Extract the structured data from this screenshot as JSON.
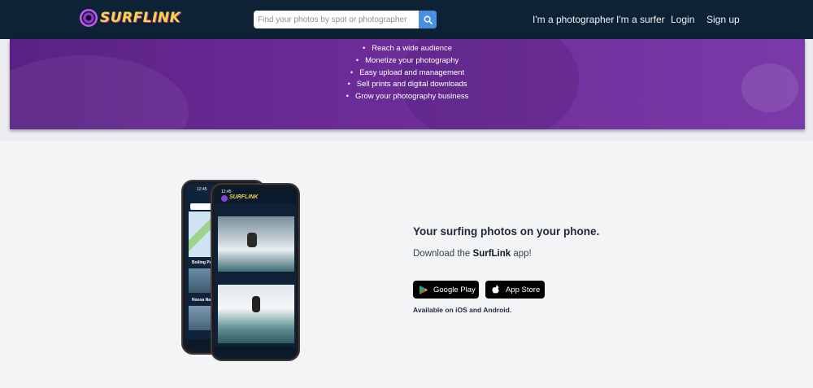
{
  "brand": {
    "name": "SURFLINK"
  },
  "search": {
    "placeholder": "Find your photos by spot or photographer"
  },
  "nav": {
    "photographer": "I'm a photographer",
    "surfer": "I'm a surfer",
    "login": "Login",
    "signup": "Sign up"
  },
  "banner": {
    "benefits": [
      "Reach a wide audience",
      "Monetize your photography",
      "Easy upload and management",
      "Sell prints and digital downloads",
      "Grow your photography business"
    ]
  },
  "app": {
    "title": "Your surfing photos on your phone.",
    "subtitle_prefix": "Download the ",
    "subtitle_brand": "SurfLink",
    "subtitle_suffix": " app!",
    "google_play": "Google Play",
    "app_store": "App Store",
    "availability": "Available on iOS and Android."
  },
  "mockup": {
    "back_time": "12:45",
    "front_time": "12:45",
    "back_spot_1": "Boiling Pot",
    "back_spot_2": "Noosa Nationa"
  },
  "colors": {
    "topbar": "#0e2236",
    "banner_purple": "#6a2b96",
    "search_button": "#4a90e2",
    "logo_yellow": "#f7d548"
  }
}
